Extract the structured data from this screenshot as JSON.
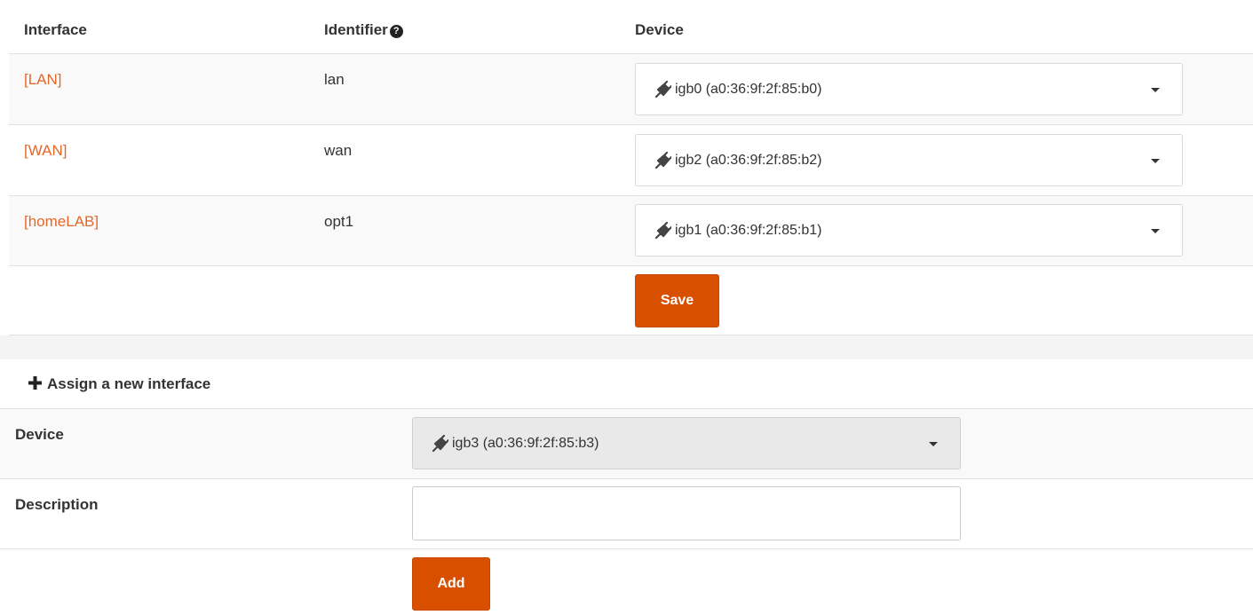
{
  "table": {
    "headers": {
      "interface": "Interface",
      "identifier": "Identifier",
      "device": "Device"
    },
    "rows": [
      {
        "interface": "[LAN]",
        "identifier": "lan",
        "device": "igb0 (a0:36:9f:2f:85:b0)"
      },
      {
        "interface": "[WAN]",
        "identifier": "wan",
        "device": "igb2 (a0:36:9f:2f:85:b2)"
      },
      {
        "interface": "[homeLAB]",
        "identifier": "opt1",
        "device": "igb1 (a0:36:9f:2f:85:b1)"
      }
    ],
    "save_label": "Save"
  },
  "icons": {
    "help": "question-circle-icon",
    "plug": "plug-icon",
    "plus": "plus-icon",
    "caret": "caret-down-icon"
  },
  "colors": {
    "accent": "#d94f00",
    "link": "#e3682a"
  },
  "new_interface": {
    "title": "Assign a new interface",
    "device_label": "Device",
    "device_value": "igb3 (a0:36:9f:2f:85:b3)",
    "description_label": "Description",
    "description_value": "",
    "add_label": "Add"
  }
}
